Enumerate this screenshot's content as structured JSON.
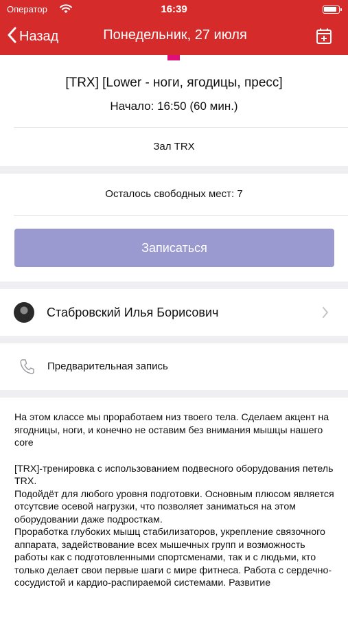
{
  "status_bar": {
    "carrier": "Оператор",
    "time": "16:39"
  },
  "nav": {
    "back_label": "Назад",
    "title": "Понедельник, 27 июля",
    "calendar_icon": "calendar-add-icon"
  },
  "class": {
    "title": "[TRX] [Lower - ноги, ягодицы, пресс]",
    "start": "Начало: 16:50 (60 мин.)",
    "room": "Зал TRX"
  },
  "booking": {
    "seats_left": "Осталось свободных мест: 7",
    "signup_label": "Записаться",
    "signup_color": "#9a9ad0"
  },
  "trainer": {
    "name": "Стабровский Илья Борисович"
  },
  "prebook": {
    "label": "Предварительная запись"
  },
  "description": {
    "p1": "На этом классе мы  проработаем низ твоего тела. Сделаем акцент на ягодницы, ноги, и конечно не оставим без внимания мышцы нашего core",
    "p2": "[TRX]-тренировка с использованием подвесного оборудования петель TRX.",
    "p3": "Подойдёт для любого уровня подготовки. Основным плюсом является отсутсвие осевой нагрузки, что позволяет  заниматься на этом оборудовании даже подросткам.",
    "p4": "Проработка глубоких мышц стабилизаторов, укрепление связочного аппарата, задействование всех мышечных групп и возможность работы как с подготовленными спортсменами, так и с людьми, кто только делает свои первые шаги с мире фитнеса. Работа с сердечно-сосудистой и кардио-распираемой системами. Развитие"
  },
  "colors": {
    "header": "#d62b2b",
    "accent_marker": "#e0107a"
  }
}
